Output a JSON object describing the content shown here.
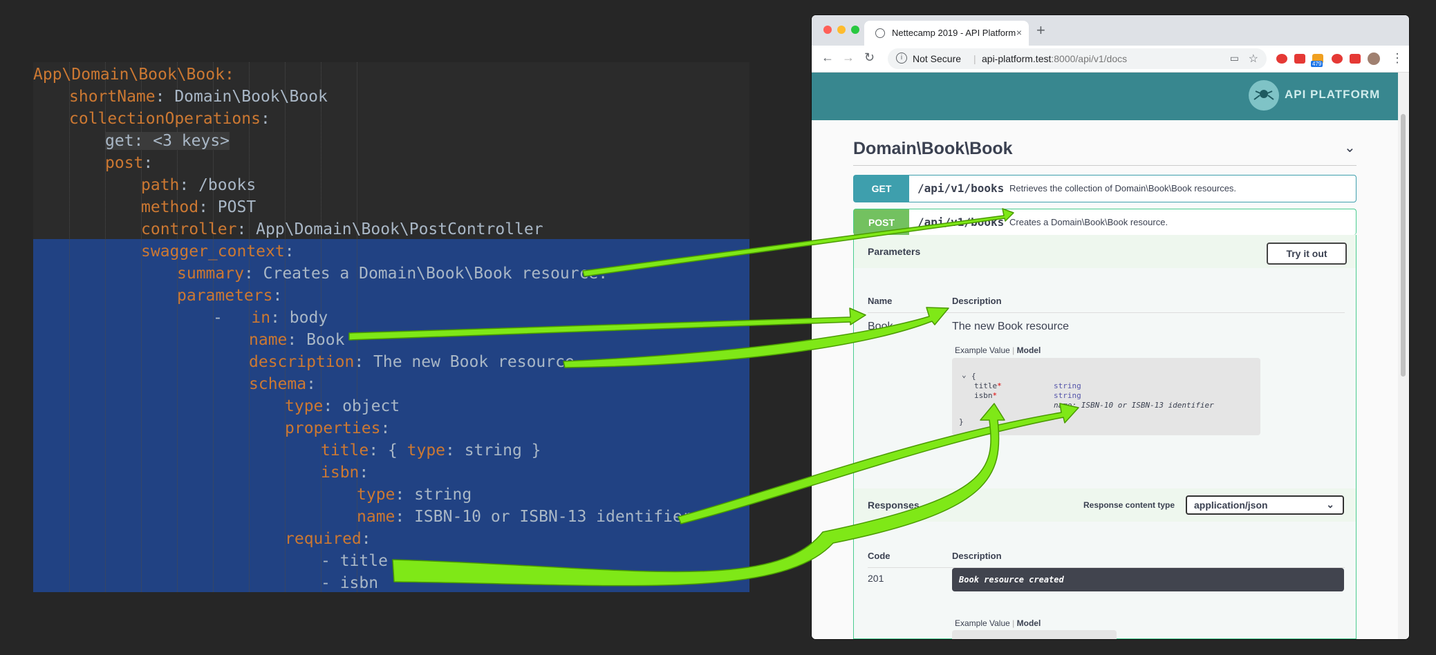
{
  "editor": {
    "lines": [
      {
        "t": "App\\Domain\\Book\\Book:",
        "k": true,
        "indent": 0
      },
      {
        "key": "shortName",
        "val": ": Domain\\Book\\Book",
        "indent": 1
      },
      {
        "key": "collectionOperations",
        "val": ":",
        "indent": 1
      },
      {
        "folded": "get: <3 keys>",
        "indent": 2
      },
      {
        "key": "post",
        "val": ":",
        "indent": 2
      },
      {
        "key": "path",
        "val": ": /books",
        "indent": 3
      },
      {
        "key": "method",
        "val": ": POST",
        "indent": 3
      },
      {
        "key": "controller",
        "val": ": App\\Domain\\Book\\PostController",
        "indent": 3
      },
      {
        "key": "swagger_context",
        "val": ":",
        "indent": 3
      },
      {
        "key": "summary",
        "val": ": Creates a Domain\\Book\\Book resource.",
        "indent": 4
      },
      {
        "key": "parameters",
        "val": ":",
        "indent": 4
      },
      {
        "pre": "-   ",
        "key": "in",
        "val": ": body",
        "indent": 5
      },
      {
        "key": "name",
        "val": ": Book",
        "indent": 6
      },
      {
        "key": "description",
        "val": ": The new Book resource",
        "indent": 6
      },
      {
        "key": "schema",
        "val": ":",
        "indent": 6
      },
      {
        "key": "type",
        "val": ": object",
        "indent": 7
      },
      {
        "key": "properties",
        "val": ":",
        "indent": 7
      },
      {
        "key": "title",
        "val": ": { ",
        "key2": "type",
        "val2": ": string }",
        "indent": 8
      },
      {
        "key": "isbn",
        "val": ":",
        "indent": 8
      },
      {
        "key": "type",
        "val": ": string",
        "indent": 9
      },
      {
        "key": "name",
        "val": ": ISBN-10 or ISBN-13 identifier",
        "indent": 9
      },
      {
        "key": "required",
        "val": ":",
        "indent": 7
      },
      {
        "pre": "- ",
        "val": "title",
        "indent": 8
      },
      {
        "pre": "- ",
        "val": "isbn",
        "indent": 8
      }
    ]
  },
  "browser": {
    "tab_title": "Nettecamp 2019 - API Platform",
    "tab_close": "×",
    "new_tab": "+",
    "nav_back": "←",
    "nav_forward": "→",
    "nav_reload": "↻",
    "security": "Not Secure",
    "url_host": "api-platform.test",
    "url_rest": ":8000/api/v1/docs",
    "ext_badge": "479",
    "menu": "⋮"
  },
  "page": {
    "logo_text": "API PLATFORM",
    "resource_title": "Domain\\Book\\Book",
    "collapse_icon": "⌄",
    "get_op": {
      "method": "GET",
      "path": "/api/v1/books",
      "summary": "Retrieves the collection of Domain\\Book\\Book resources."
    },
    "post_op": {
      "method": "POST",
      "path": "/api/v1/books",
      "summary": "Creates a Domain\\Book\\Book resource."
    },
    "parameters_label": "Parameters",
    "try_button": "Try it out",
    "col_name": "Name",
    "col_description": "Description",
    "param_name": "Book",
    "param_desc": "The new Book resource",
    "example_value": "Example Value",
    "model": "Model",
    "schema": {
      "open": "{",
      "fields": [
        {
          "name": "title",
          "type": "string",
          "note": ""
        },
        {
          "name": "isbn",
          "type": "string",
          "note": "name: ISBN-10 or ISBN-13 identifier"
        }
      ],
      "close": "}"
    },
    "responses_label": "Responses",
    "response_content_type_label": "Response content type",
    "response_content_type": "application/json",
    "col_code": "Code",
    "response_code": "201",
    "response_desc": "Book resource created"
  },
  "colors": {
    "get": "#3e9fad",
    "post": "#49cc90",
    "arrow": "#7fe817",
    "header": "#38878f"
  }
}
